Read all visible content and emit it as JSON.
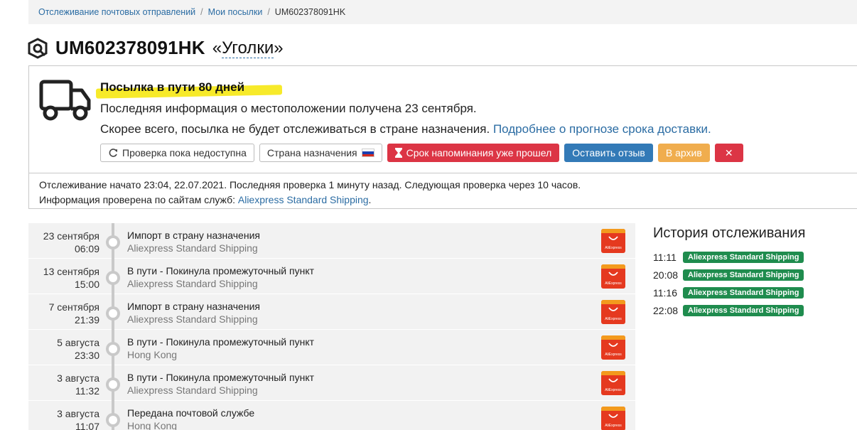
{
  "breadcrumb": {
    "items": [
      "Отслеживание почтовых отправлений",
      "Мои посылки"
    ],
    "separator": "/",
    "current": "UM602378091HK"
  },
  "title": {
    "track_number": "UM602378091HK",
    "quote_open": "«",
    "nickname": "Уголки",
    "quote_close": "»"
  },
  "status": {
    "headline": "Посылка в пути 80 дней",
    "line1": "Последняя информация о местоположении получена 23 сентября.",
    "line2": "Скорее всего, посылка не будет отслеживаться в стране назначения.",
    "line2_link": "Подробнее о прогнозе срока доставки.",
    "highlight_color": "#f7ea2a"
  },
  "buttons": {
    "check": "Проверка пока недоступна",
    "destination": "Страна назначения",
    "reminder": "Срок напоминания уже прошел",
    "review": "Оставить отзыв",
    "archive": "В архив",
    "close": "✕"
  },
  "info": {
    "line1": "Отслеживание начато 23:04, 22.07.2021. Последняя проверка 1 минуту назад. Следующая проверка через 10 часов.",
    "line2_prefix": "Информация проверена по сайтам служб:",
    "line2_link": "Aliexpress Standard Shipping",
    "line2_suffix": "."
  },
  "events": [
    {
      "date": "23 сентября",
      "time": "06:09",
      "title": "Импорт в страну назначения",
      "sub": "Aliexpress Standard Shipping"
    },
    {
      "date": "13 сентября",
      "time": "15:00",
      "title": "В пути - Покинула промежуточный пункт",
      "sub": "Aliexpress Standard Shipping"
    },
    {
      "date": "7 сентября",
      "time": "21:39",
      "title": "Импорт в страну назначения",
      "sub": "Aliexpress Standard Shipping"
    },
    {
      "date": "5 августа",
      "time": "23:30",
      "title": "В пути - Покинула промежуточный пункт",
      "sub": "Hong Kong"
    },
    {
      "date": "3 августа",
      "time": "11:32",
      "title": "В пути - Покинула промежуточный пункт",
      "sub": "Aliexpress Standard Shipping"
    },
    {
      "date": "3 августа",
      "time": "11:07",
      "title": "Передана почтовой службе",
      "sub": "Hong Kong"
    }
  ],
  "ali_label": "AliExpress",
  "history": {
    "title": "История отслеживания",
    "rows": [
      {
        "time": "11:11",
        "badge": "Aliexpress Standard Shipping"
      },
      {
        "time": "20:08",
        "badge": "Aliexpress Standard Shipping"
      },
      {
        "time": "11:16",
        "badge": "Aliexpress Standard Shipping"
      },
      {
        "time": "22:08",
        "badge": "Aliexpress Standard Shipping"
      }
    ]
  },
  "colors": {
    "link": "#2b6ca3",
    "danger": "#dc3545",
    "primary": "#337ab7",
    "warning": "#f0ad4e",
    "success": "#1f8c4e"
  }
}
